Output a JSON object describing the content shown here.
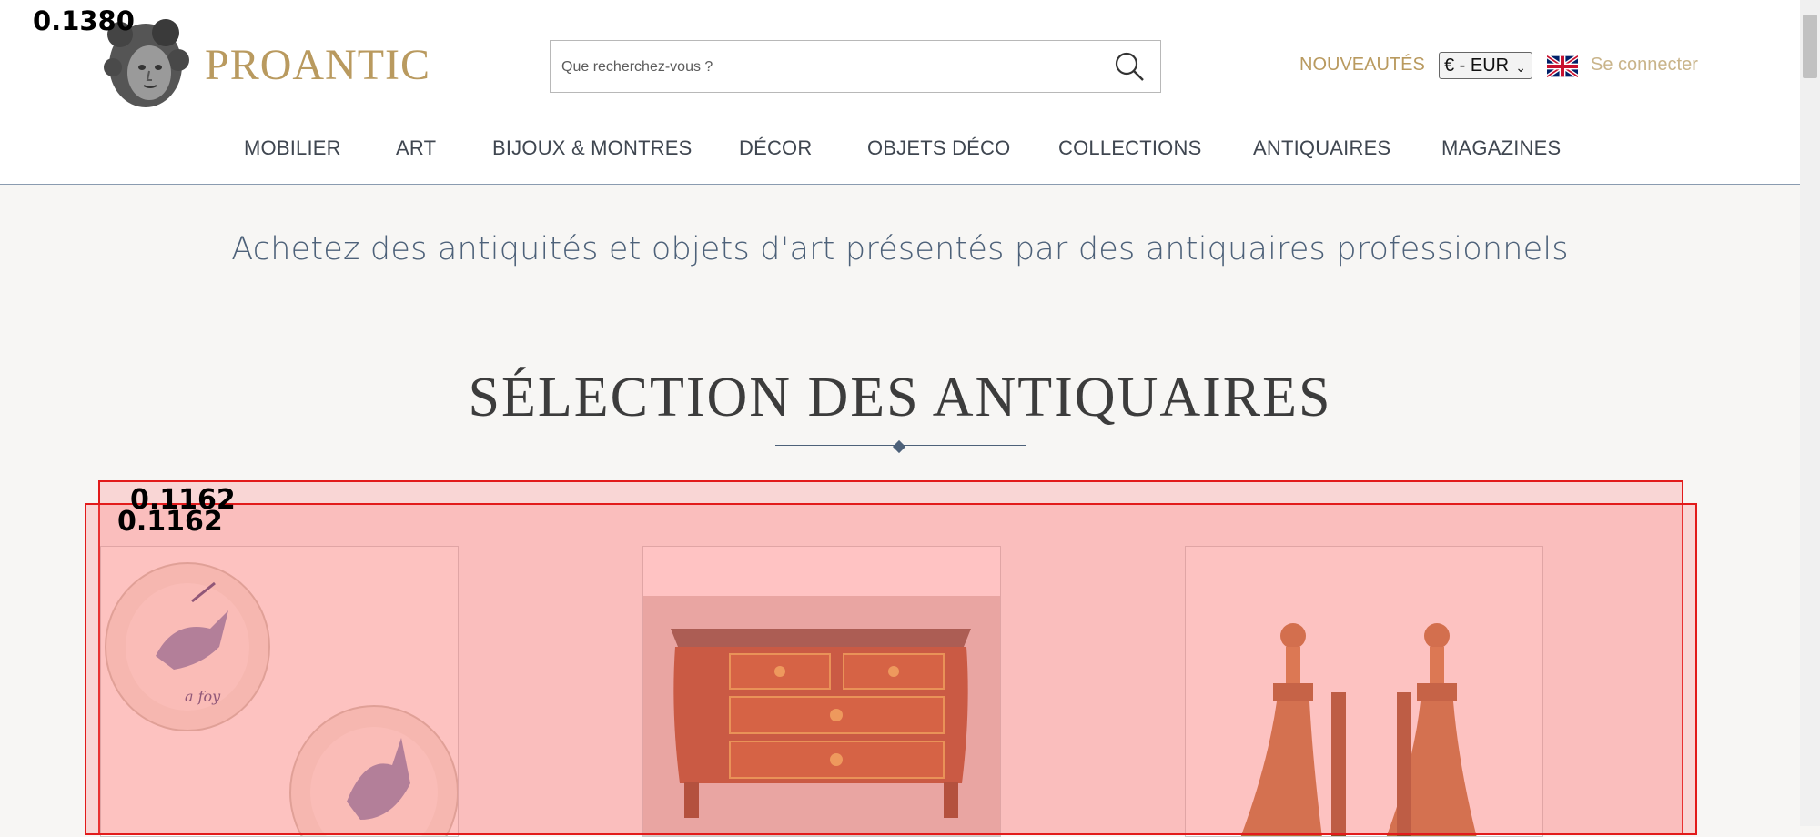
{
  "logo": {
    "text": "PROANTIC",
    "icon": "medusa-head-logo"
  },
  "search": {
    "placeholder": "Que recherchez-vous ?",
    "icon": "search-icon"
  },
  "header_links": {
    "new": "NOUVEAUTÉS",
    "currency": "€ - EUR",
    "language_icon": "uk-flag-icon",
    "login": "Se connecter"
  },
  "nav": {
    "items": [
      "MOBILIER",
      "ART",
      "BIJOUX & MONTRES",
      "DÉCOR",
      "OBJETS DÉCO",
      "COLLECTIONS",
      "ANTIQUAIRES",
      "MAGAZINES"
    ]
  },
  "tagline": "Achetez des antiquités et objets d'art présentés par des antiquaires professionnels",
  "section": {
    "title": "SÉLECTION DES ANTIQUAIRES"
  },
  "cards": [
    {
      "name": "delft-plates",
      "caption": "a foy"
    },
    {
      "name": "marquetry-commode"
    },
    {
      "name": "carved-andirons"
    }
  ],
  "overlay": {
    "top_left_label": "0.1380",
    "score_a": "0.1162",
    "score_b": "0.1162"
  },
  "colors": {
    "accent_gold": "#b99a5f",
    "nav_text": "#3f4650",
    "tagline_blue": "#4d6179",
    "overlay_red": "#e21b1b"
  }
}
